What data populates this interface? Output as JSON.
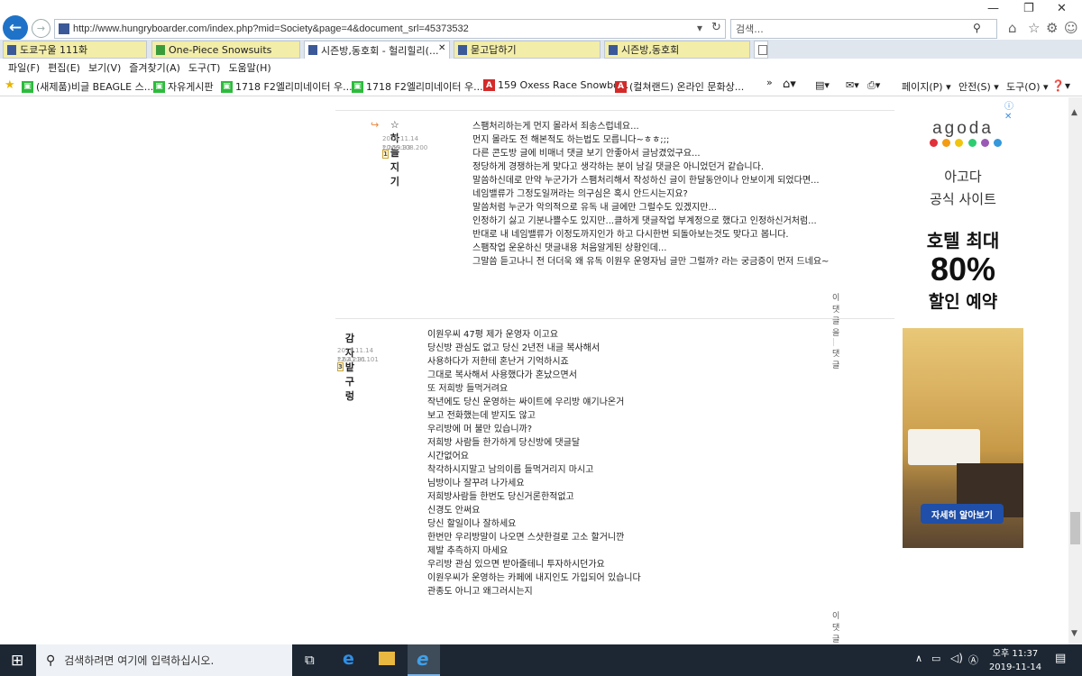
{
  "browser": {
    "url": "http://www.hungryboarder.com/index.php?mid=Society&page=4&document_srl=45373532",
    "search_placeholder": "검색...",
    "tabs": [
      {
        "label": "도쿄구울 111화",
        "icon": "page-icon"
      },
      {
        "label": "One-Piece Snowsuits",
        "icon": "site-icon"
      },
      {
        "label": "시즌방,동호회 - 헐리힐리(...",
        "icon": "page-icon"
      },
      {
        "label": "묻고답하기",
        "icon": "page-icon"
      },
      {
        "label": "시즌방,동호회",
        "icon": "page-icon"
      }
    ],
    "menu": [
      "파일(F)",
      "편집(E)",
      "보기(V)",
      "즐겨찾기(A)",
      "도구(T)",
      "도움말(H)"
    ],
    "favorites": [
      {
        "label": "(새제품)비글 BEAGLE 스...",
        "color": "#2dbb3c",
        "glyph": "▣"
      },
      {
        "label": "자유게시판",
        "color": "#2dbb3c",
        "glyph": "▣"
      },
      {
        "label": "1718 F2엘리미네이터 우...",
        "color": "#2dbb3c",
        "glyph": "▣"
      },
      {
        "label": "1718 F2엘리미네이터 우...",
        "color": "#2dbb3c",
        "glyph": "▣"
      },
      {
        "label": "159 Oxess Race Snowbo...",
        "color": "#d42a2a",
        "glyph": "A"
      },
      {
        "label": "(컬쳐랜드) 온라인 문화상...",
        "color": "#d42a2a",
        "glyph": "A"
      }
    ],
    "commands": [
      "페이지(P) ▾",
      "안전(S) ▾",
      "도구(O) ▾"
    ]
  },
  "comments": [
    {
      "author": "☆하늘지기",
      "level": "1",
      "date": "2019.11.14 20:59:33",
      "ip": "*.206.108.200",
      "lines": [
        "스팸처리하는게 먼지 몰라서 죄송스럽네요...",
        "먼지 몰라도 전 해본적도 하는법도 모릅니다~ㅎㅎ;;;",
        "다른 콘도방 글에 비매너 댓글 보기 안좋아서 글남겼었구요...",
        "정당하게 경쟁하는게 맞다고 생각하는 분이 남길 댓글은 아니었던거 같습니다.",
        "말씀하신데로 만약 누군가가 스팸처리해서 작성하신 글이 한달동안이나 안보이게 되었다면...",
        "네임밸류가 그정도일꺼라는 의구심은 혹시 안드시는지요?",
        "말씀처럼 누군가 악의적으로 유독 내 글에만 그럴수도 있겠지만...",
        "인정하기 싫고 기분나쁠수도 있지만...클하게 댓글작업 부계정으로 했다고 인정하신거처럼...",
        "반대로 내 네임밸류가 이정도까지인가 하고 다시한번 되돌아보는것도 맞다고 봅니다.",
        "스팸작업 운운하신 댓글내용 처음알게된 상황인데...",
        "그말씀 듣고나니 전 더더욱 왜 유독 이원우 운영자님 글만 그럴까? 라는 궁금증이 먼저 드네요~"
      ],
      "actions": [
        "이 댓글을",
        "댓글"
      ]
    },
    {
      "author": "감자밭구렁",
      "level": "3",
      "date": "2019.11.14 22:41:31",
      "ip": "*.62.216.101",
      "lines": [
        "이원우씨 47평 제가 운영자 이고요",
        "당신방 관심도 없고 당신 2년전 내글 복사해서",
        "사용하다가 저한테 혼난거 기억하시죠",
        "그대로 복사해서 사용했다가 혼났으면서",
        "또 저희방 들먹거려요",
        "작년에도 당신 운영하는 싸이트에 우리방 얘기나온거",
        "보고 전화했는데 받지도 않고",
        "우리방에 머 불만 있습니까?",
        "저희방 사람들 한가하게 당신방에 댓글달",
        "시간없어요",
        "착각하시지말고 남의이름 들먹거리지 마시고",
        "님방이나 잘꾸려 나가세요",
        "저희방사람들 한번도 당신거론한적없고",
        "신경도 안써요",
        "당신 할일이나 잘하세요",
        "한번만 우리방말이 나오면 스샷한걸로 고소 할거니깐",
        "제발 추측하지 마세요",
        "우리방 관심 있으면 받아줄테니 투자하시던가요",
        "이원우씨가 운영하는 카페에 내지인도 가입되어 있습니다",
        "관종도 아니고 왜그러시는지"
      ],
      "actions": [
        "이 댓글을",
        "댓글"
      ]
    }
  ],
  "ad": {
    "brand": "agoda",
    "dot_colors": [
      "#e0303a",
      "#f39c12",
      "#f1c40f",
      "#2ecc71",
      "#9b59b6",
      "#3498db"
    ],
    "line1": "아고다",
    "line2": "공식 사이트",
    "headline": "호텔 최대",
    "percent": "80%",
    "sub": "할인 예약",
    "cta": "자세히 알아보기"
  },
  "taskbar": {
    "search_placeholder": "검색하려면 여기에 입력하십시오.",
    "time": "오후 11:37",
    "date": "2019-11-14"
  }
}
